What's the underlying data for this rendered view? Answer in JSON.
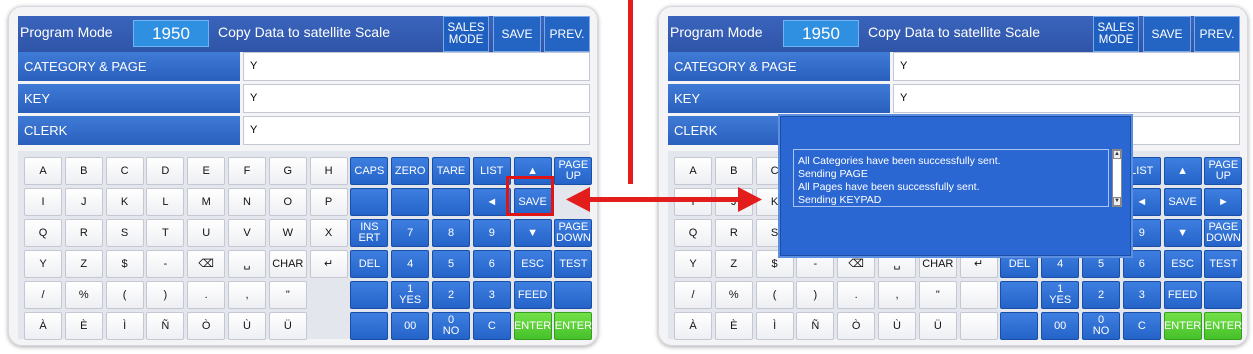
{
  "screen": {
    "mode_label": "Program Mode",
    "program_number": "1950",
    "description": "Copy Data to satellite Scale",
    "sales_mode_label": "SALES\nMODE",
    "save_label": "SAVE",
    "prev_label": "PREV."
  },
  "fields": [
    {
      "label": "CATEGORY & PAGE",
      "value": "Y"
    },
    {
      "label": "KEY",
      "value": "Y"
    },
    {
      "label": "CLERK",
      "value": "Y"
    }
  ],
  "keyboard": {
    "rows": [
      [
        "A",
        "B",
        "C",
        "D",
        "E",
        "F",
        "G",
        "H",
        "CAPS",
        "ZERO",
        "TARE",
        "LIST",
        "▲",
        "PAGE\nUP"
      ],
      [
        "I",
        "J",
        "K",
        "L",
        "M",
        "N",
        "O",
        "P",
        "",
        "",
        "",
        "◄",
        "SAVE",
        "►"
      ],
      [
        "Q",
        "R",
        "S",
        "T",
        "U",
        "V",
        "W",
        "X",
        "INS\nERT",
        "7",
        "8",
        "9",
        "▼",
        "PAGE\nDOWN"
      ],
      [
        "Y",
        "Z",
        "$",
        "-",
        "⌫",
        "␣",
        "CHAR",
        "↵",
        "DEL",
        "4",
        "5",
        "6",
        "ESC",
        "TEST"
      ],
      [
        "/",
        "%",
        "(",
        ")",
        ".",
        ",",
        "\"",
        "",
        "",
        "1\nYES",
        "2",
        "3",
        "FEED",
        ""
      ],
      [
        "À",
        "È",
        "Ì",
        "Ñ",
        "Ò",
        "Ù",
        "Ü",
        "",
        "",
        "00",
        "0\nNO",
        "C",
        "ENTER",
        "ENTER"
      ]
    ],
    "left_missing": [
      [
        1,
        13
      ],
      [
        4,
        7
      ],
      [
        5,
        7
      ]
    ]
  },
  "popup": {
    "lines": [
      "All Categories have been successfully sent.",
      "Sending PAGE",
      "All Pages have been successfully sent.",
      "Sending KEYPAD"
    ]
  },
  "colors": {
    "annotation": "#e31c1c",
    "key_blue": "#2a6ad2",
    "key_green": "#4cc72e"
  }
}
